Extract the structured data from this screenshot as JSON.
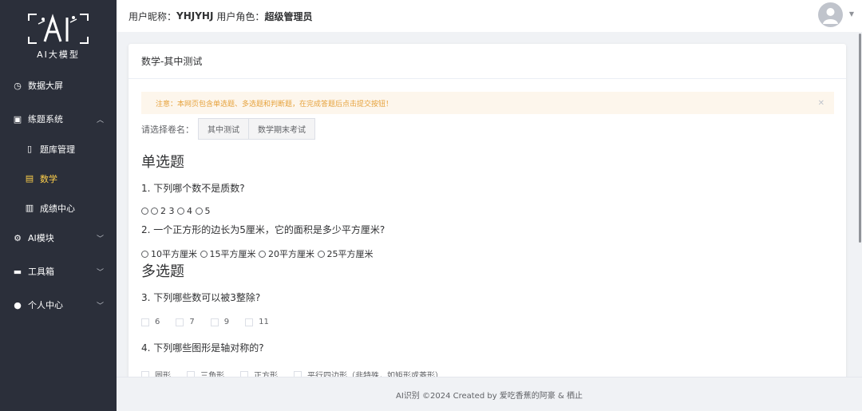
{
  "sidebar": {
    "logo_text": "AI大模型",
    "items": [
      {
        "icon": "dashboard-icon",
        "label": "数据大屏"
      },
      {
        "icon": "save-icon",
        "label": "练题系统"
      },
      {
        "icon": "square-icon",
        "label": "题库管理"
      },
      {
        "icon": "document-icon",
        "label": "数学"
      },
      {
        "icon": "copy-icon",
        "label": "成绩中心"
      },
      {
        "icon": "cpu-icon",
        "label": "AI模块"
      },
      {
        "icon": "toolbox-icon",
        "label": "工具箱"
      },
      {
        "icon": "user-icon",
        "label": "个人中心"
      }
    ],
    "active_color": "#ffd04b",
    "bg_color": "#2b2f3a"
  },
  "header": {
    "nickname_label": "用户昵称：",
    "nickname": "YHJYHJ",
    "role_label": "用户角色：",
    "role": "超级管理员"
  },
  "card": {
    "title": "数学-其中测试",
    "alert": "注意：本网页包含单选题、多选题和判断题，在完成答题后点击提交按钮！",
    "paper_label": "请选择卷名：",
    "papers": [
      "其中测试",
      "数学期末考试"
    ],
    "single_title": "单选题",
    "multi_title": "多选题",
    "questions": [
      {
        "text": "1. 下列哪个数不是质数?",
        "options": [
          "2",
          "3",
          "4",
          "5"
        ]
      },
      {
        "text": "2. 一个正方形的边长为5厘米，它的面积是多少平方厘米?",
        "options": [
          "10平方厘米",
          "15平方厘米",
          "20平方厘米",
          "25平方厘米"
        ]
      },
      {
        "text": "3. 下列哪些数可以被3整除?",
        "options": [
          "6",
          "7",
          "9",
          "11"
        ]
      },
      {
        "text": "4. 下列哪些图形是轴对称的?",
        "options": [
          "圆形",
          "三角形",
          "正方形",
          "平行四边形（非特殊，如矩形或菱形）"
        ]
      }
    ]
  },
  "footer": {
    "text": "AI识别 ©2024 Created by 爱吃香蕉的阿豪 & 栖止"
  }
}
